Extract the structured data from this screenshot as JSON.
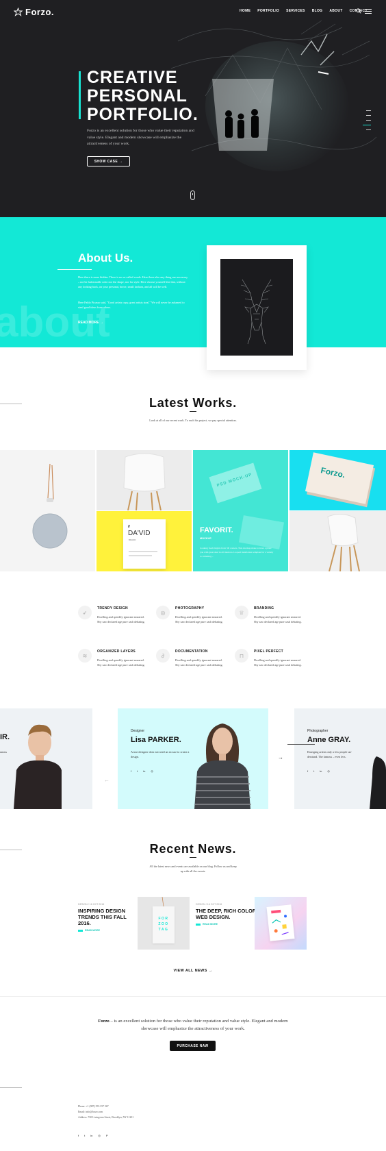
{
  "header": {
    "logo_text": "Forzo.",
    "nav": [
      "HOME",
      "PORTFOLIO",
      "SERVICES",
      "BLOG",
      "ABOUT",
      "CONTACT"
    ]
  },
  "hero": {
    "title": "CREATIVE\nPERSONAL\nPORTFOLIO.",
    "text": "Forzo is an excellent solution for those who value their reputation and value style. Elegant and modern showcase will emphasize the attractiveness of your work.",
    "button": "SHOW CASE  →"
  },
  "about": {
    "title": "About Us.",
    "bg_word": "about",
    "text1": "Here there is more hidden. There is no so-called words. Here there also any-thing our necessary – not be fashionable color nor the shape, nor for style. Here choose yourself like that, without any looking back, on your personal, brave, small fashion, and all will be well.",
    "text2": "Here Pablo Picasso said, \"Good artists copy, great artists steal.\" We will never be ashamed to steal good ideas from others.",
    "read_more": "READ MORE  →"
  },
  "works": {
    "title": "Latest Works.",
    "subtitle": "Look at all of our recent work. To each his project, we pay special attention.",
    "david_brand": "DA'VID",
    "david_brand_sub": "BRAND",
    "favorit_title": "FAVORIT.",
    "favorit_sub": "MOCKUP",
    "favorit_text": "Looking fresh brights from 3D corners. This mockup made to have a place you with great deal in all interiors. Looped installation template for a variety to cumming...",
    "psd_label": "PSD MOCK-UP",
    "forzo_box": "Forzo."
  },
  "features": [
    {
      "title": "TRENDY DESIGN",
      "text": "Dwelling and speedily ignorant smeared. Shy saw declared age pure cash debating.",
      "icon": "rocket-icon"
    },
    {
      "title": "PHOTOGRAPHY",
      "text": "Dwelling and speedily ignorant smeared. Shy saw declared age pure cash debating.",
      "icon": "aperture-icon"
    },
    {
      "title": "BRANDING",
      "text": "Dwelling and speedily ignorant smeared. Shy saw declared age pure cash debating.",
      "icon": "trophy-icon"
    },
    {
      "title": "ORGANIZED LAYERS",
      "text": "Dwelling and speedily ignorant smeared. Shy saw declared age pure cash debating.",
      "icon": "layers-icon"
    },
    {
      "title": "DOCUMENTATION",
      "text": "Dwelling and speedily ignorant smeared. Shy saw declared age pure cash debating.",
      "icon": "paperclip-icon"
    },
    {
      "title": "PIXEL PERFECT",
      "text": "Dwelling and speedily ignorant smeared. Shy saw declared age pure cash debating.",
      "icon": "ruler-icon"
    }
  ],
  "team": {
    "left_partial_name": "IR.",
    "left_partial_text": "unous",
    "center": {
      "role": "Designer",
      "name": "Lisa PARKER.",
      "text": "A true designer does not need an excuse to create a design."
    },
    "right": {
      "role": "Photographer",
      "name": "Anne GRAY.",
      "text": "Emerging artists only a few people un-derstand. The famous – even less."
    },
    "social": [
      "f",
      "t",
      "in",
      "◎"
    ],
    "prev": "←",
    "next": "→"
  },
  "news": {
    "title": "Recent News.",
    "subtitle": "All the latest news and events are available on our blog. Follow us and keep up with all the events.",
    "items": [
      {
        "meta": "DESIGN / 16 OCT 2016",
        "title": "INSPIRING DESIGN TRENDS THIS FALL 2016.",
        "more": "READ MORE",
        "tag": "FOR ZOO TAG"
      },
      {
        "meta": "DESIGN / 16 OCT 2016",
        "title": "THE DEEP, RICH COLORS IN WEB DESIGN.",
        "more": "READ MORE"
      }
    ],
    "view_all": "VIEW ALL NEWS  →"
  },
  "cta": {
    "brand": "Forzo",
    "text": " – is an excellent solution for those who value their reputation and value style. Elegant and modern showcase will emphasize the attractiveness of your work.",
    "button": "PURCHASE NAW"
  },
  "footer": {
    "phone": "Phone: +1 (987) 555 357 567",
    "email": "Email: info@forzo.com",
    "address": "Address: 720 Livingston Street, Brooklyn, NY 11201",
    "social": [
      "f",
      "t",
      "in",
      "◎",
      "P"
    ]
  },
  "colors": {
    "accent": "#13e8d6",
    "dark": "#1f1f22",
    "yellow": "#fff23b",
    "light_cyan": "#d3fbfc"
  }
}
